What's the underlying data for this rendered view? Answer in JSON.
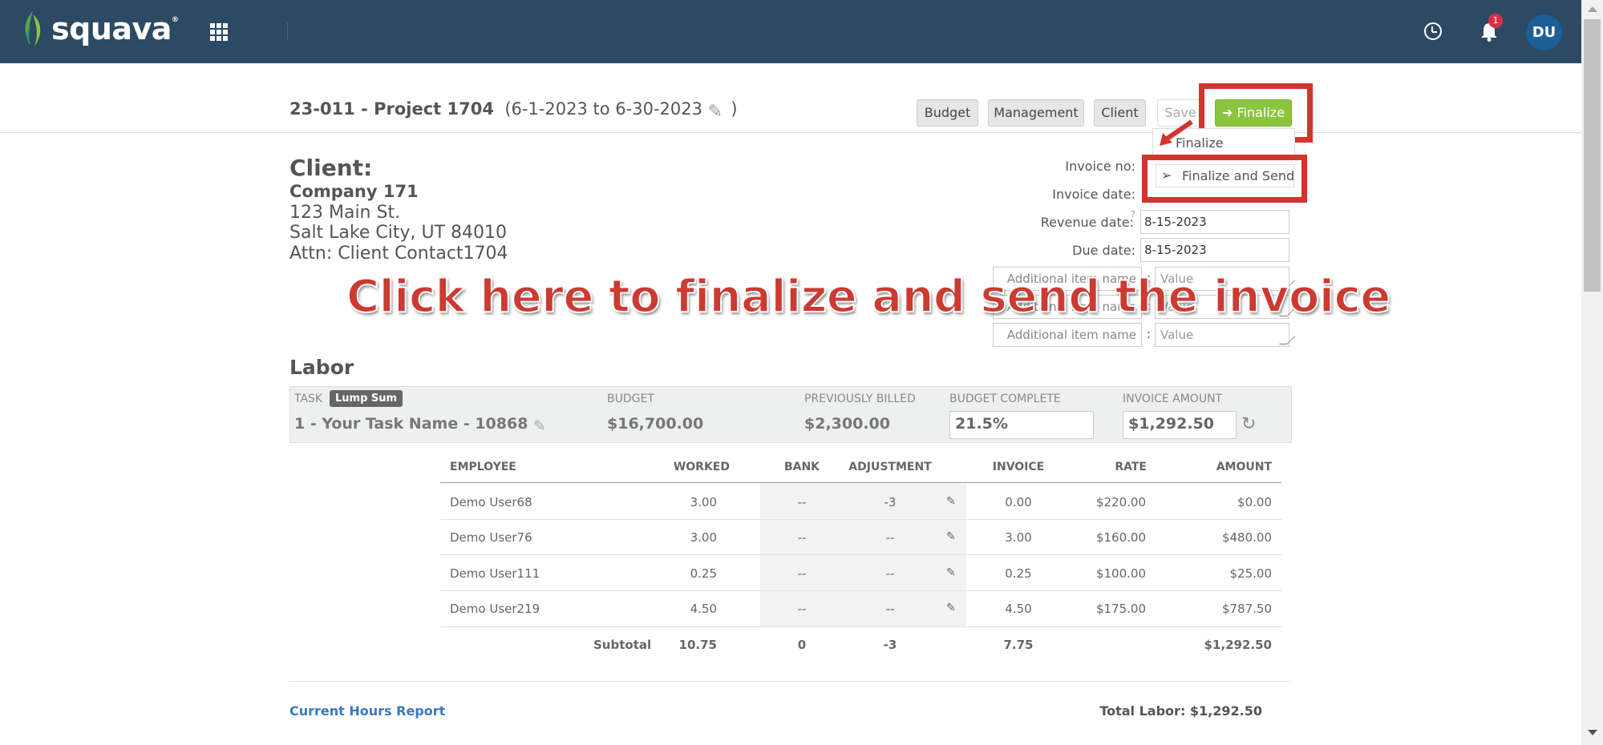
{
  "app": {
    "brand": "squava",
    "notification_count": "1",
    "avatar_initials": "DU"
  },
  "header": {
    "project": "23-011 - Project 1704",
    "period": "(6-1-2023 to 6-30-2023",
    "period_close": ")",
    "buttons": {
      "budget": "Budget",
      "management": "Management",
      "client": "Client",
      "save": "Save",
      "finalize": "Finalize"
    },
    "dropdown": {
      "finalize": "Finalize",
      "finalize_send": "Finalize and Send"
    }
  },
  "client": {
    "heading": "Client:",
    "company": "Company 171",
    "address1": "123 Main St.",
    "address2": "Salt Lake City, UT 84010",
    "attn": "Attn: Client Contact1704"
  },
  "invoice_fields": {
    "invoice_no_label": "Invoice no:",
    "invoice_date_label": "Invoice date:",
    "revenue_date_label": "Revenue date:",
    "revenue_date": "8-15-2023",
    "due_date_label": "Due date:",
    "due_date": "8-15-2023",
    "additional_name_placeholder": "Additional item name",
    "additional_value_placeholder": "Value"
  },
  "annotation": {
    "callout": "Click here to finalize and send the invoice"
  },
  "labor": {
    "heading": "Labor",
    "task_label": "Task",
    "lump_sum": "Lump Sum",
    "task_name": "1 - Your Task Name - 10868",
    "budget_label": "Budget",
    "budget": "$16,700.00",
    "prev_billed_label": "Previously Billed",
    "prev_billed": "$2,300.00",
    "budget_complete_label": "Budget Complete",
    "budget_complete": "21.5%",
    "invoice_amount_label": "Invoice Amount",
    "invoice_amount": "$1,292.50"
  },
  "table": {
    "headers": {
      "employee": "Employee",
      "worked": "Worked",
      "bank": "Bank",
      "adjustment": "Adjustment",
      "invoice": "Invoice",
      "rate": "Rate",
      "amount": "Amount"
    },
    "rows": [
      {
        "employee": "Demo User68",
        "worked": "3.00",
        "bank": "--",
        "adjustment": "-3",
        "invoice": "0.00",
        "rate": "$220.00",
        "amount": "$0.00"
      },
      {
        "employee": "Demo User76",
        "worked": "3.00",
        "bank": "--",
        "adjustment": "--",
        "invoice": "3.00",
        "rate": "$160.00",
        "amount": "$480.00"
      },
      {
        "employee": "Demo User111",
        "worked": "0.25",
        "bank": "--",
        "adjustment": "--",
        "invoice": "0.25",
        "rate": "$100.00",
        "amount": "$25.00"
      },
      {
        "employee": "Demo User219",
        "worked": "4.50",
        "bank": "--",
        "adjustment": "--",
        "invoice": "4.50",
        "rate": "$175.00",
        "amount": "$787.50"
      }
    ],
    "subtotal": {
      "label": "Subtotal",
      "worked": "10.75",
      "bank": "0",
      "adjustment": "-3",
      "invoice": "7.75",
      "amount": "$1,292.50"
    }
  },
  "footer": {
    "report_link": "Current Hours Report",
    "total_labor": "Total Labor: $1,292.50"
  },
  "colors": {
    "topbar": "#2c4a63",
    "finalize_green": "#8bc540",
    "highlight_red": "#d2352e",
    "link_blue": "#3a78c0"
  },
  "icons": [
    "apps-grid-icon",
    "clock-icon",
    "bell-icon",
    "pencil-icon",
    "send-icon",
    "refresh-icon",
    "edit-icon",
    "arrow-right-icon"
  ]
}
